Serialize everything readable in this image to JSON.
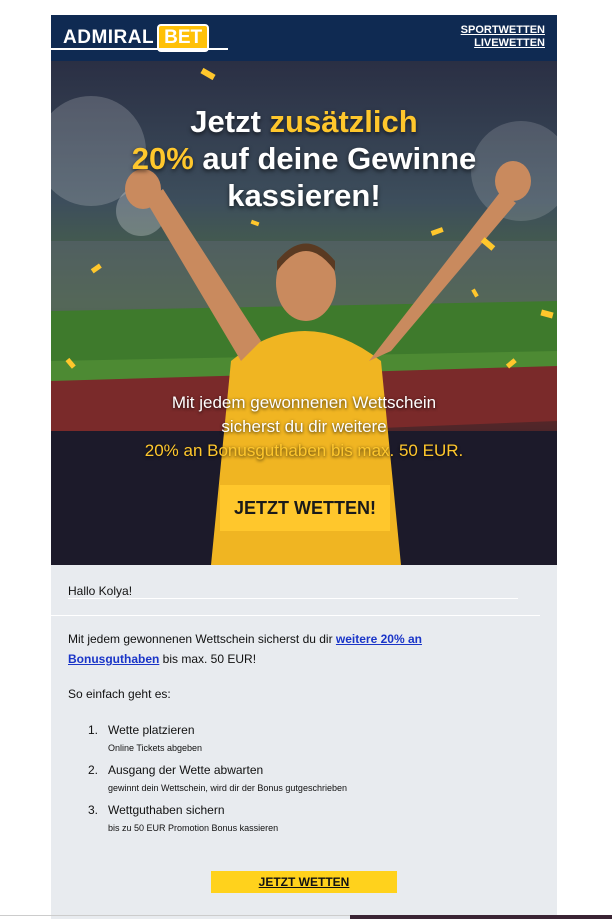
{
  "header": {
    "logo_part1": "ADMIRAL",
    "logo_part2": "BET",
    "nav": [
      "SPORTWETTEN",
      "LIVEWETTEN"
    ]
  },
  "hero": {
    "headline_line1_a": "Jetzt ",
    "headline_line1_b": "zusätzlich",
    "headline_line2_a": "20%",
    "headline_line2_b": " auf deine Gewinne",
    "headline_line3": "kassieren!",
    "sub_line1": "Mit jedem gewonnenen Wettschein",
    "sub_line2": "sicherst du dir weitere",
    "sub_line3": "20% an Bonusguthaben bis max. 50 EUR.",
    "cta": "JETZT WETTEN!"
  },
  "body": {
    "greeting": "Hallo Kolya!",
    "para_a": "Mit jedem gewonnenen Wettschein sicherst du dir ",
    "para_link": "weitere 20% an Bonusguthaben",
    "para_b": " bis max. 50 EUR!",
    "intro": "So einfach geht es:",
    "steps": [
      {
        "num": "1.",
        "title": "Wette platzieren",
        "desc": "Online Tickets abgeben"
      },
      {
        "num": "2.",
        "title": "Ausgang der Wette abwarten",
        "desc": "gewinnt dein Wettschein, wird dir der Bonus gutgeschrieben"
      },
      {
        "num": "3.",
        "title": "Wettguthaben sichern",
        "desc": "bis zu 50 EUR Promotion Bonus kassieren"
      }
    ],
    "cta": "JETZT WETTEN"
  },
  "colors": {
    "navy": "#0f2a52",
    "accent_yellow": "#ffc72c",
    "link_blue": "#1a35c8",
    "content_bg": "#e8ebef"
  }
}
